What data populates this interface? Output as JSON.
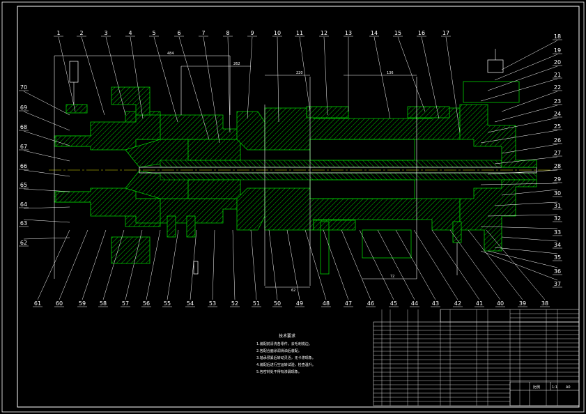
{
  "drawing": {
    "top_labels": [
      "1",
      "2",
      "3",
      "4",
      "5",
      "6",
      "7",
      "8",
      "9",
      "10",
      "11",
      "12",
      "13",
      "14",
      "15",
      "16",
      "17"
    ],
    "right_labels": [
      "18",
      "19",
      "20",
      "21",
      "22",
      "23",
      "24",
      "25",
      "26",
      "27",
      "28",
      "29",
      "30",
      "31",
      "32",
      "33",
      "34",
      "35",
      "36",
      "37"
    ],
    "bottom_labels": [
      "61",
      "60",
      "59",
      "58",
      "57",
      "56",
      "55",
      "54",
      "53",
      "52",
      "51",
      "50",
      "49",
      "48",
      "47",
      "46",
      "45",
      "44",
      "43",
      "42",
      "41",
      "40",
      "39",
      "38"
    ],
    "left_labels": [
      "70",
      "69",
      "68",
      "67",
      "66",
      "65",
      "64",
      "63",
      "62"
    ],
    "dimension_texts": [
      "484",
      "262",
      "220",
      "136",
      "62",
      "72"
    ],
    "tech_requirements": {
      "title": "技术要求",
      "lines": [
        "1.装配前清洗各零件，去毛刺锐边。",
        "2.各配合面涂润滑油后装配。",
        "3.轴承预紧后转动灵活，无卡滞现象。",
        "4.装配后进行空运转试验，检查温升。",
        "5.各密封处不得有渗漏现象。"
      ]
    },
    "title_block": {
      "cells": [
        "比例",
        "1:1",
        "A0"
      ]
    }
  },
  "colors": {
    "background": "#000000",
    "frame": "#ffffff",
    "section": "#00d000",
    "centerline": "#e6e600",
    "labels": "#ffffff"
  }
}
